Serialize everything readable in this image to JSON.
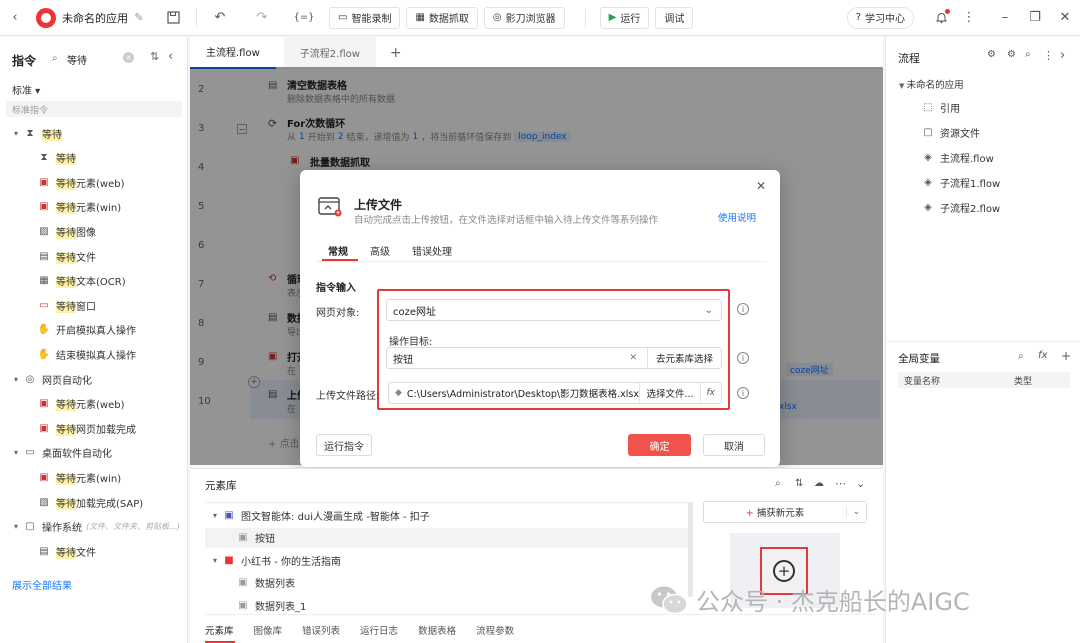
{
  "topbar": {
    "app_title": "未命名的应用",
    "record_label": "智能录制",
    "capture_label": "数据抓取",
    "browser_label": "影刀浏览器",
    "run_label": "运行",
    "debug_label": "调试",
    "learn_label": "学习中心"
  },
  "left": {
    "title": "指令",
    "search_value": "等待",
    "filter_label": "标准",
    "section_label": "标准指令",
    "items": [
      {
        "label": "等待",
        "level": 0,
        "icon": "hourglass"
      },
      {
        "label": "等待",
        "level": 1,
        "icon": "hourglass"
      },
      {
        "label": "等待元素(web)",
        "level": 1,
        "icon": "element"
      },
      {
        "label": "等待元素(win)",
        "level": 1,
        "icon": "element"
      },
      {
        "label": "等待图像",
        "level": 1,
        "icon": "image"
      },
      {
        "label": "等待文件",
        "level": 1,
        "icon": "file"
      },
      {
        "label": "等待文本(OCR)",
        "level": 1,
        "icon": "ocr"
      },
      {
        "label": "等待窗口",
        "level": 1,
        "icon": "window"
      },
      {
        "label": "开启模拟真人操作",
        "level": 1,
        "icon": "hand"
      },
      {
        "label": "结束模拟真人操作",
        "level": 1,
        "icon": "hand"
      },
      {
        "label": "网页自动化",
        "level": 0,
        "icon": "globe"
      },
      {
        "label": "等待元素(web)",
        "level": 1,
        "icon": "element"
      },
      {
        "label": "等待网页加载完成",
        "level": 1,
        "icon": "element"
      },
      {
        "label": "桌面软件自动化",
        "level": 0,
        "icon": "desktop"
      },
      {
        "label": "等待元素(win)",
        "level": 1,
        "icon": "element"
      },
      {
        "label": "等待加载完成(SAP)",
        "level": 1,
        "icon": "sap"
      },
      {
        "label": "操作系统",
        "level": 0,
        "icon": "os",
        "hint": "(文件、文件夹、剪贴板...)"
      },
      {
        "label": "等待文件",
        "level": 1,
        "icon": "file"
      }
    ],
    "show_all": "展示全部结果"
  },
  "editor": {
    "tabs": [
      "主流程.flow",
      "子流程2.flow"
    ],
    "lines": [
      {
        "num": "2",
        "title": "清空数据表格",
        "desc": "删除数据表格中的所有数据"
      },
      {
        "num": "3",
        "title": "For次数循环",
        "desc_parts": [
          "从",
          "1",
          "开始到",
          "2",
          "结束，递增值为",
          "1",
          "，将当前循环值保存到",
          "loop_index"
        ]
      },
      {
        "num": "4",
        "title": "批量数据抓取",
        "desc": ""
      },
      {
        "num": "5",
        "title": "",
        "desc": ""
      },
      {
        "num": "6",
        "title": "",
        "desc": ""
      },
      {
        "num": "7",
        "title": "循环",
        "desc": "表示"
      },
      {
        "num": "8",
        "title": "数据",
        "desc": "导出"
      },
      {
        "num": "9",
        "title": "打开",
        "desc": "在",
        "tag": "coze网址"
      },
      {
        "num": "10",
        "title": "上传",
        "desc": "在",
        "tag": "xlsx"
      }
    ],
    "add_hint": "点击"
  },
  "dialog": {
    "title": "上传文件",
    "subtitle": "自动完成点击上传按钮，在文件选择对话框中输入待上传文件等系列操作",
    "help_link": "使用说明",
    "tabs": [
      "常规",
      "高级",
      "错误处理"
    ],
    "section": "指令输入",
    "page_label": "网页对象:",
    "page_value": "coze网址",
    "target_label": "操作目标:",
    "target_value": "按钮",
    "target_btn": "去元素库选择",
    "path_label": "上传文件路径:",
    "path_value": "C:\\Users\\Administrator\\Desktop\\影刀数据表格.xlsx",
    "path_btn": "选择文件...",
    "fx_label": "fx",
    "run_btn": "运行指令",
    "ok_btn": "确定",
    "cancel_btn": "取消"
  },
  "right": {
    "title": "流程",
    "app_name": "未命名的应用",
    "items": [
      {
        "label": "引用",
        "icon": "ref"
      },
      {
        "label": "资源文件",
        "icon": "folder"
      },
      {
        "label": "主流程.flow",
        "icon": "layers"
      },
      {
        "label": "子流程1.flow",
        "icon": "layers"
      },
      {
        "label": "子流程2.flow",
        "icon": "layers"
      }
    ],
    "vars_title": "全局变量",
    "col_name": "变量名称",
    "col_type": "类型"
  },
  "elib": {
    "title": "元素库",
    "rows": [
      {
        "label": "图文智能体: dui人漫画生成 -智能体 - 扣子",
        "level": 0,
        "icon": "app"
      },
      {
        "label": "按钮",
        "level": 1,
        "icon": "element"
      },
      {
        "label": "小红书 - 你的生活指南",
        "level": 0,
        "icon": "xhs"
      },
      {
        "label": "数据列表",
        "level": 1,
        "icon": "element"
      },
      {
        "label": "数据列表_1",
        "level": 1,
        "icon": "element"
      }
    ],
    "capture_btn": "捕获新元素",
    "bottom_tabs": [
      "元素库",
      "图像库",
      "错误列表",
      "运行日志",
      "数据表格",
      "流程参数"
    ]
  },
  "watermark": "公众号 · 杰克船长的AIGC",
  "colors": {
    "accent": "#1677ff",
    "ok": "#f0534c",
    "highlight_border": "#e23b3b",
    "search_hl": "#fff2a8"
  }
}
